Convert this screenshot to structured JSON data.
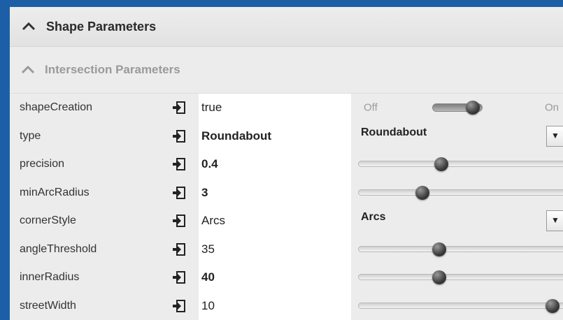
{
  "section": {
    "title": "Shape Parameters",
    "icon": "chevron-up-icon"
  },
  "subsection": {
    "title": "Intersection Parameters",
    "icon": "chevron-up-icon"
  },
  "parameters": [
    {
      "name": "shapeCreation",
      "value": "true",
      "bold": false,
      "control": "toggle",
      "off_label": "Off",
      "on_label": "On",
      "state": "on"
    },
    {
      "name": "type",
      "value": "Roundabout",
      "bold": true,
      "control": "select",
      "selected": "Roundabout"
    },
    {
      "name": "precision",
      "value": "0.4",
      "bold": true,
      "control": "slider",
      "level": 0.4
    },
    {
      "name": "minArcRadius",
      "value": "3",
      "bold": true,
      "control": "slider",
      "level": 0.3
    },
    {
      "name": "cornerStyle",
      "value": "Arcs",
      "bold": false,
      "control": "select",
      "selected": "Arcs"
    },
    {
      "name": "angleThreshold",
      "value": "35",
      "bold": false,
      "control": "slider",
      "level": 0.39
    },
    {
      "name": "innerRadius",
      "value": "40",
      "bold": true,
      "control": "slider",
      "level": 0.39
    },
    {
      "name": "streetWidth",
      "value": "10",
      "bold": false,
      "control": "slider",
      "level": 0.98
    }
  ],
  "icons": {
    "link": "link-icon",
    "dropdown": "dropdown-arrow-icon"
  }
}
